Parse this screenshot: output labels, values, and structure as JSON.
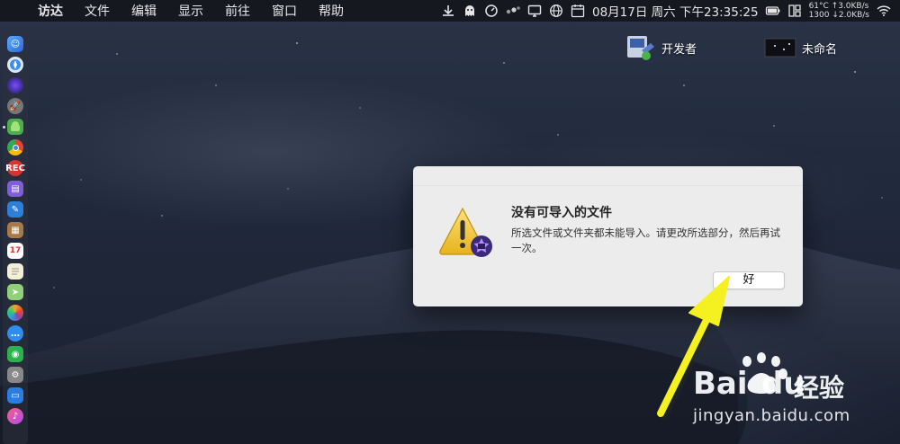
{
  "menubar": {
    "apple_glyph": "",
    "app_name": "访达",
    "menus": [
      "文件",
      "编辑",
      "显示",
      "前往",
      "窗口",
      "帮助"
    ],
    "clock": "08月17日 周六 下午23:35:25",
    "net_line1": "61°C ↑3.0KB/s",
    "net_line2": "1300 ↓2.0KB/s"
  },
  "desktop": {
    "items": [
      {
        "label": "开发者",
        "icon": "developer-folder-icon"
      },
      {
        "label": "未命名",
        "icon": "screenshot-thumbnail-icon"
      }
    ]
  },
  "dock": {
    "icons": [
      "finder-icon",
      "safari-compass-icon",
      "siri-icon",
      "launchpad-rocket-icon",
      "android-icon",
      "chrome-icon",
      "record-icon",
      "notes-icon",
      "xcode-icon",
      "notebook-icon",
      "calendar-icon",
      "textedit-icon",
      "maps-icon",
      "photos-icon",
      "messages-icon",
      "wechat-icon",
      "system-preferences-icon",
      "keynote-icon",
      "itunes-icon"
    ],
    "calendar_day": "17"
  },
  "dialog": {
    "title": "没有可导入的文件",
    "message": "所选文件或文件夹都未能导入。请更改所选部分，然后再试一次。",
    "ok_label": "好",
    "icon": "warning-imovie-icon"
  },
  "watermark": {
    "brand": "Bai du",
    "text": "经验",
    "url": "jingyan.baidu.com"
  },
  "colors": {
    "arrow": "#f5f020",
    "dialog_bg": "#ececec",
    "menubar_bg": "#16181d"
  }
}
